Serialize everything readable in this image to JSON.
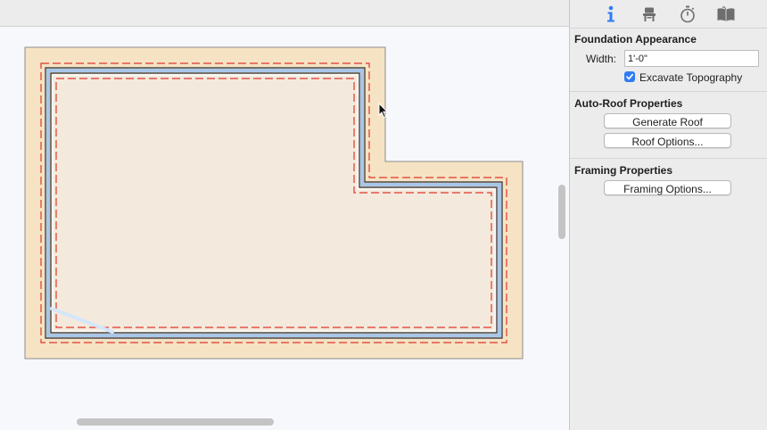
{
  "inspector": {
    "tabs": [
      {
        "name": "info-icon",
        "label": "Info"
      },
      {
        "name": "furniture-chair-icon",
        "label": "Objects"
      },
      {
        "name": "stopwatch-icon",
        "label": "History"
      },
      {
        "name": "book-library-icon",
        "label": "Library"
      }
    ],
    "foundation": {
      "title": "Foundation Appearance",
      "width_label": "Width:",
      "width_value": "1'-0\"",
      "excavate_label": "Excavate Topography",
      "excavate_checked": true
    },
    "auto_roof": {
      "title": "Auto-Roof Properties",
      "generate_roof_label": "Generate Roof",
      "roof_options_label": "Roof Options..."
    },
    "framing": {
      "title": "Framing Properties",
      "framing_options_label": "Framing Options..."
    }
  },
  "colors": {
    "foundation_fill": "#f5e3c4",
    "floor_fill": "#f3eadd",
    "wall_blue": "#a9c6e8",
    "dash_red": "#e0372b",
    "accent": "#2f7cf6"
  }
}
